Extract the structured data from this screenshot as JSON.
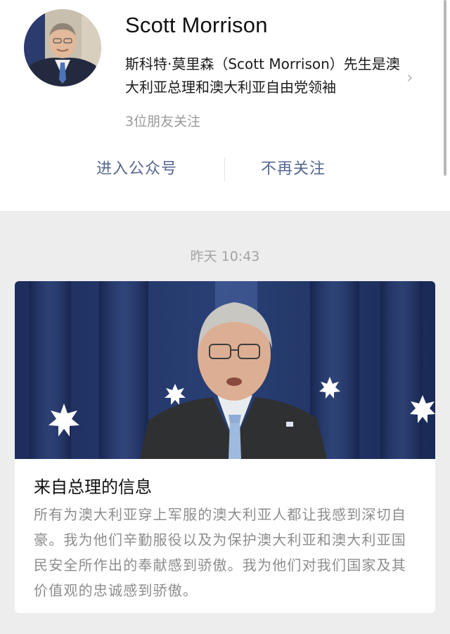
{
  "account": {
    "name": "Scott Morrison",
    "description": "斯科特·莫里森（Scott Morrison）先生是澳大利亚总理和澳大利亚自由党领袖",
    "friends_following": "3位朋友关注",
    "enter_button": "进入公众号",
    "unfollow_button": "不再关注"
  },
  "feed": {
    "timestamp": "昨天 10:43",
    "article": {
      "title": "来自总理的信息",
      "text": "所有为澳大利亚穿上军服的澳大利亚人都让我感到深切自豪。我为他们辛勤服役以及为保护澳大利亚和澳大利亚国民安全所作出的奉献感到骄傲。我为他们对我们国家及其价值观的忠诚感到骄傲。"
    }
  },
  "icons": {
    "chevron": "chevron-right-icon"
  },
  "colors": {
    "link_blue": "#556790",
    "background": "#ededed"
  }
}
